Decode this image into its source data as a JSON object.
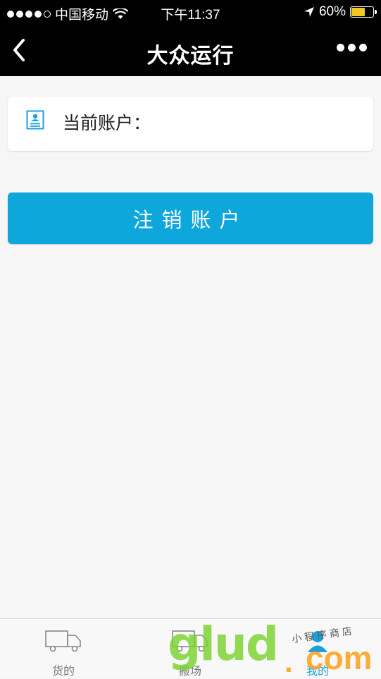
{
  "status_bar": {
    "carrier": "中国移动",
    "time": "下午11:37",
    "battery_percent": "60%",
    "battery_level": 0.6,
    "signal_bars": 4,
    "icons": [
      "signal-dots-icon",
      "wifi-icon",
      "location-arrow-icon",
      "battery-icon"
    ]
  },
  "nav": {
    "title": "大众运行",
    "back_icon": "chevron-left-icon",
    "more_icon": "more-dots-icon"
  },
  "account": {
    "label": "当前账户：",
    "value": "",
    "icon": "contact-card-icon"
  },
  "actions": {
    "logout_label": "注销账户"
  },
  "tabs": [
    {
      "label": "货的",
      "icon": "truck-icon",
      "active": false
    },
    {
      "label": "搬场",
      "icon": "moving-truck-icon",
      "active": false
    },
    {
      "label": "我的",
      "icon": "user-icon",
      "active": true
    }
  ],
  "watermark": {
    "text": "glud",
    "suffix": ".com",
    "small_text": "小程序商店"
  },
  "colors": {
    "primary": "#0ea7dc",
    "nav_bg": "#000000",
    "page_bg": "#f6f6f6",
    "battery": "#f3c623",
    "active_tab": "#1aa1da"
  }
}
